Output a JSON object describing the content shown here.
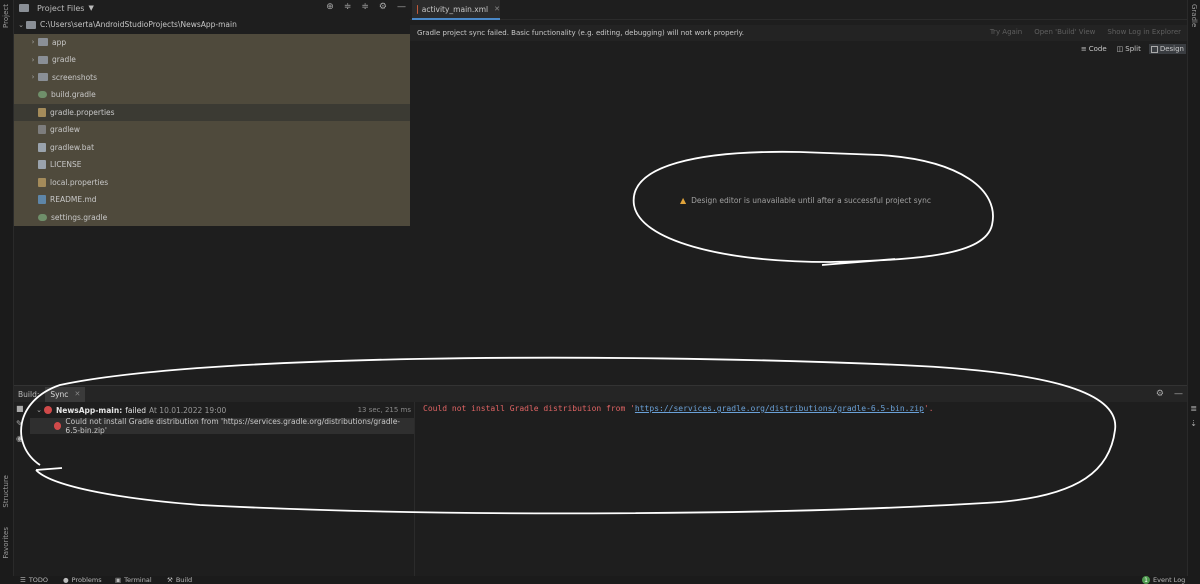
{
  "left_stripe": {
    "project": "Project",
    "structure": "Structure",
    "favorites": "Favorites"
  },
  "right_stripe": {
    "gradle": "Gradle"
  },
  "project_panel": {
    "title": "Project Files",
    "tools": [
      "⊕",
      "≑",
      "≑",
      "⚙",
      "—"
    ],
    "root": "C:\\Users\\serta\\AndroidStudioProjects\\NewsApp-main",
    "items": [
      {
        "label": "app",
        "type": "folder"
      },
      {
        "label": "gradle",
        "type": "folder"
      },
      {
        "label": "screenshots",
        "type": "folder"
      },
      {
        "label": "build.gradle",
        "type": "gradle"
      },
      {
        "label": "gradle.properties",
        "type": "prop"
      },
      {
        "label": "gradlew",
        "type": "sh"
      },
      {
        "label": "gradlew.bat",
        "type": "file"
      },
      {
        "label": "LICENSE",
        "type": "file"
      },
      {
        "label": "local.properties",
        "type": "prop"
      },
      {
        "label": "README.md",
        "type": "md"
      },
      {
        "label": "settings.gradle",
        "type": "gradle"
      }
    ]
  },
  "editor": {
    "tab_label": "activity_main.xml",
    "banner_text": "Gradle project sync failed. Basic functionality (e.g. editing, debugging) will not work properly.",
    "banner_actions": [
      "Try Again",
      "Open 'Build' View",
      "Show Log in Explorer"
    ],
    "view_modes": [
      "Code",
      "Split",
      "Design"
    ],
    "design_message": "Design editor is unavailable until after a successful project sync"
  },
  "build": {
    "label": "Build:",
    "tab": "Sync",
    "root_name": "NewsApp-main:",
    "root_status": "failed",
    "root_time": "At 10.01.2022 19:00",
    "duration": "13 sec, 215 ms",
    "child_error": "Could not install Gradle distribution from 'https://services.gradle.org/distributions/gradle-6.5-bin.zip'",
    "console_prefix": "Could not install Gradle distribution from '",
    "console_link": "https://services.gradle.org/distributions/gradle-6.5-bin.zip",
    "console_suffix": "'."
  },
  "status_bar": {
    "todo": "TODO",
    "problems": "Problems",
    "terminal": "Terminal",
    "build": "Build",
    "event_log": "Event Log",
    "event_count": "1"
  },
  "colors": {
    "highlight_row": "#4f4a3c",
    "error_red": "#d04a4a",
    "link_blue": "#6aa1d8",
    "warning": "#e0a33a"
  }
}
